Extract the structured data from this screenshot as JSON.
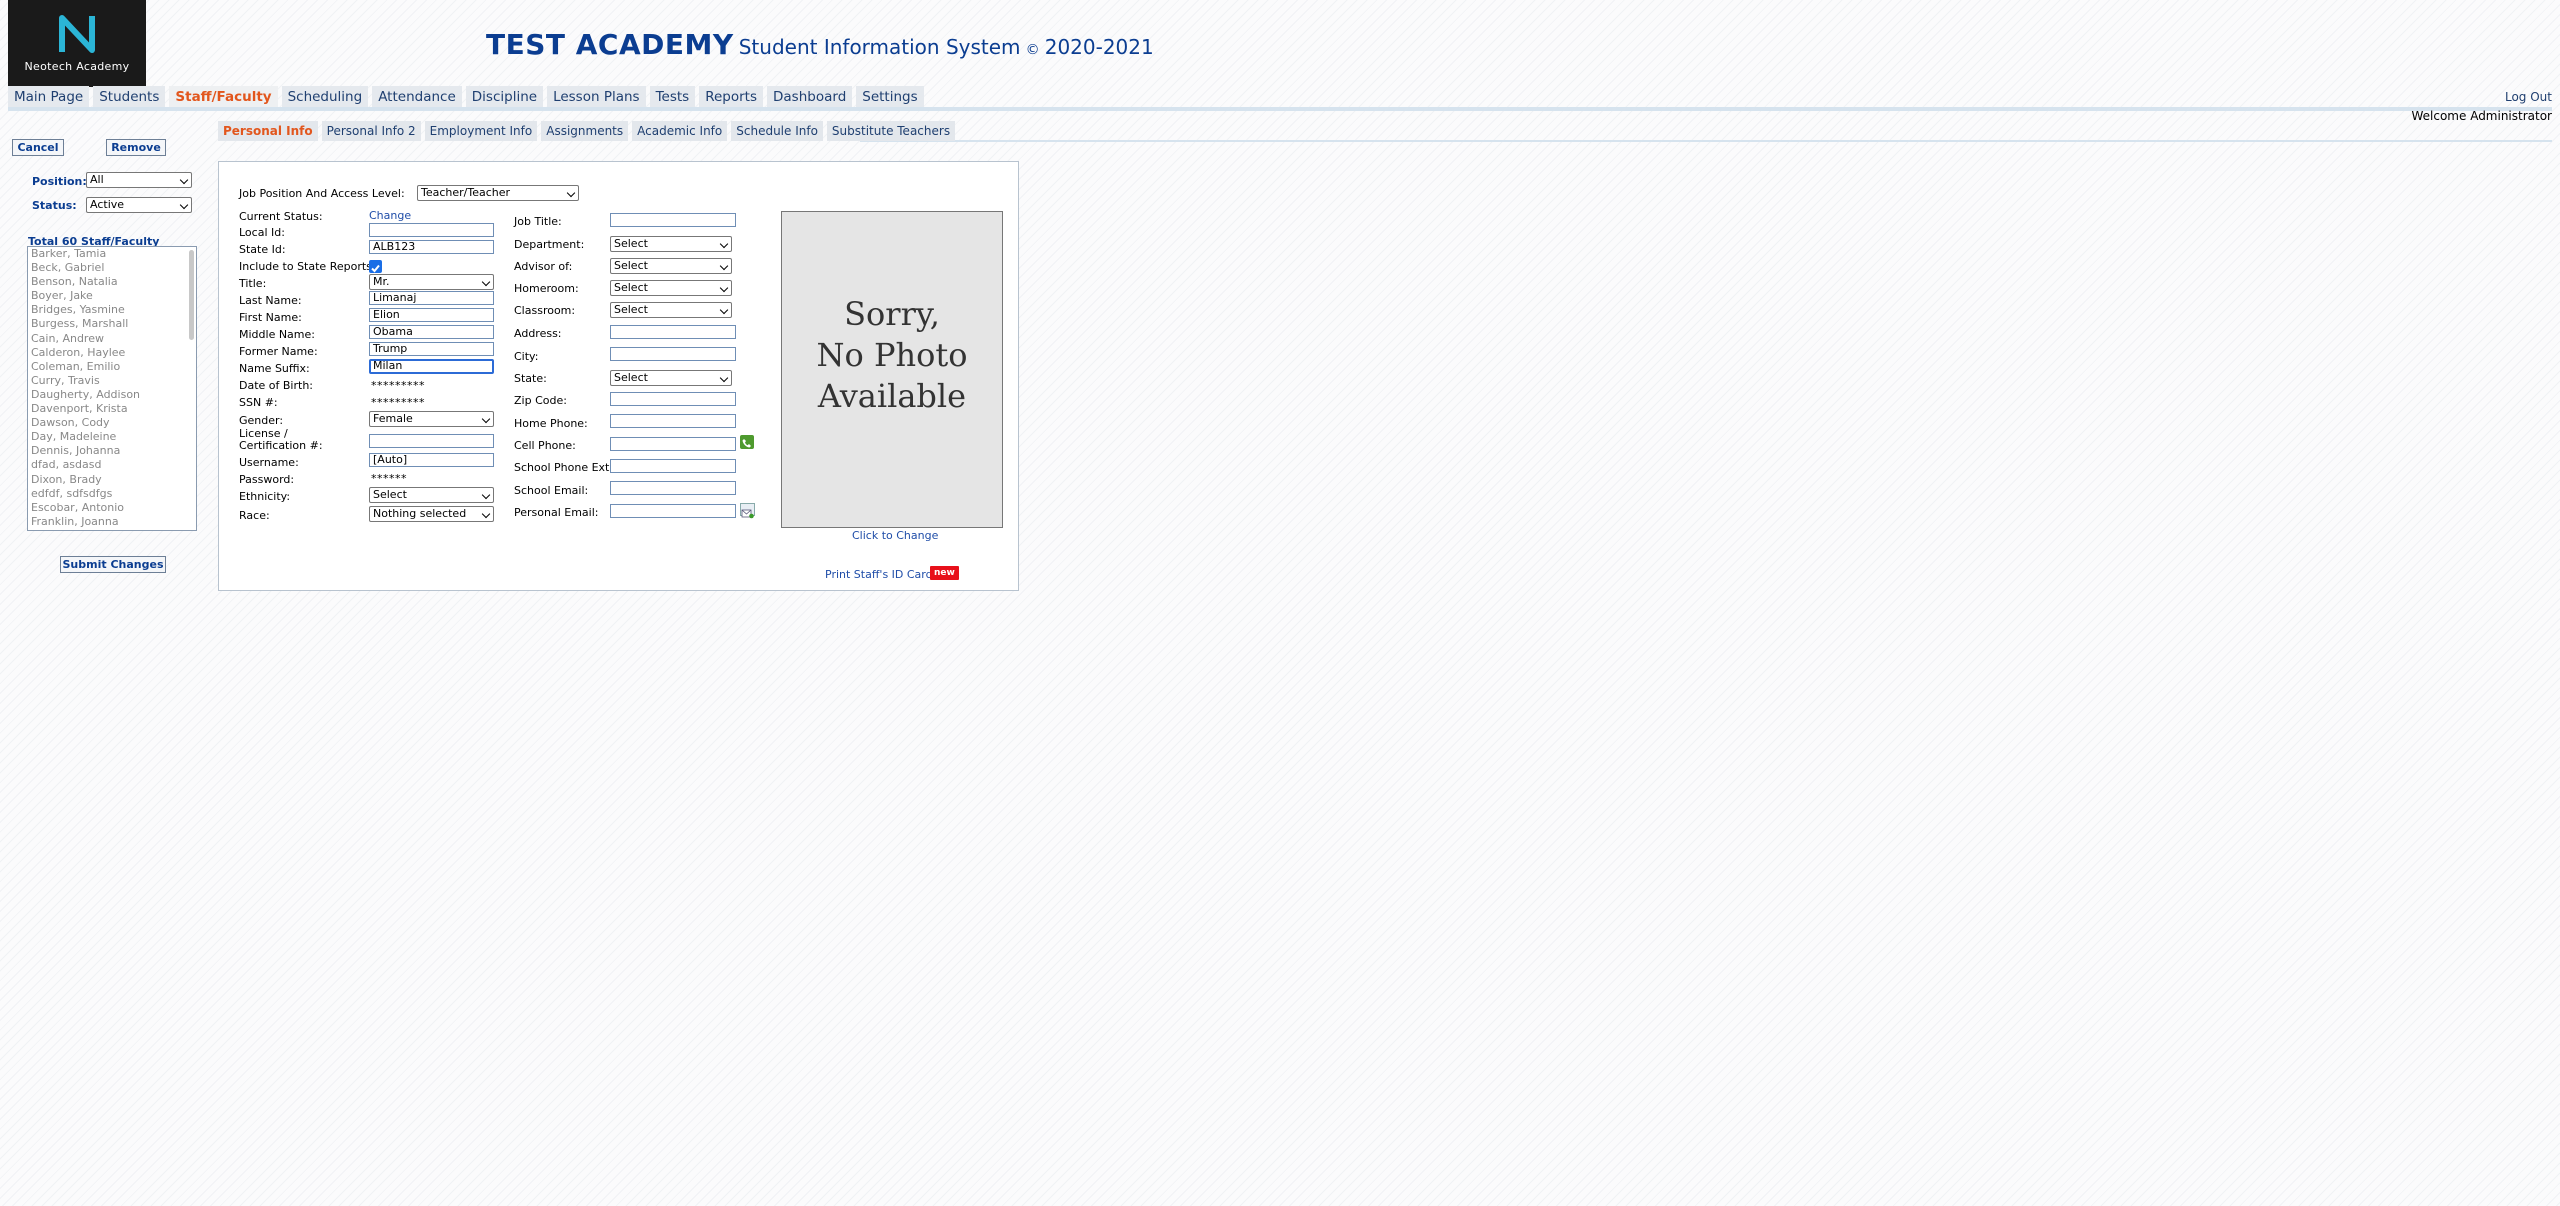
{
  "brand": {
    "logo_text": "Neotech Academy"
  },
  "header": {
    "school": "TEST ACADEMY",
    "system": "Student Information System",
    "copyright": "©",
    "years": "2020-2021"
  },
  "nav": {
    "items": [
      {
        "label": "Main Page"
      },
      {
        "label": "Students"
      },
      {
        "label": "Staff/Faculty",
        "active": true
      },
      {
        "label": "Scheduling"
      },
      {
        "label": "Attendance"
      },
      {
        "label": "Discipline"
      },
      {
        "label": "Lesson Plans"
      },
      {
        "label": "Tests"
      },
      {
        "label": "Reports"
      },
      {
        "label": "Dashboard"
      },
      {
        "label": "Settings"
      }
    ],
    "logout": "Log Out",
    "welcome": "Welcome Administrator"
  },
  "subtabs": [
    {
      "label": "Personal Info",
      "active": true
    },
    {
      "label": "Personal Info 2"
    },
    {
      "label": "Employment Info"
    },
    {
      "label": "Assignments"
    },
    {
      "label": "Academic Info"
    },
    {
      "label": "Schedule Info"
    },
    {
      "label": "Substitute Teachers"
    }
  ],
  "sidebar": {
    "cancel": "Cancel",
    "remove": "Remove",
    "position_label": "Position:",
    "position_value": "All",
    "status_label": "Status:",
    "status_value": "Active",
    "total": "Total 60 Staff/Faculty",
    "staff": [
      "Barker, Tamia",
      "Beck, Gabriel",
      "Benson, Natalia",
      "Boyer, Jake",
      "Bridges, Yasmine",
      "Burgess, Marshall",
      "Cain, Andrew",
      "Calderon, Haylee",
      "Coleman, Emilio",
      "Curry, Travis",
      "Daugherty, Addison",
      "Davenport, Krista",
      "Dawson, Cody",
      "Day, Madeleine",
      "Dennis, Johanna",
      "dfad, asdasd",
      "Dixon, Brady",
      "edfdf, sdfsdfgs",
      "Escobar, Antonio",
      "Franklin, Joanna"
    ],
    "submit": "Submit Changes"
  },
  "form": {
    "job_position_label": "Job Position And Access Level:",
    "job_position_value": "Teacher/Teacher",
    "current_status_label": "Current Status:",
    "change_link": "Change",
    "local_id_label": "Local Id:",
    "local_id": "",
    "state_id_label": "State Id:",
    "state_id": "ALB123",
    "include_state_label": "Include to State Reports:",
    "include_state_checked": true,
    "title_label": "Title:",
    "title_value": "Mr.",
    "last_name_label": "Last Name:",
    "last_name": "Limanaj",
    "first_name_label": "First Name:",
    "first_name": "Elion",
    "middle_name_label": "Middle Name:",
    "middle_name": "Obama",
    "former_name_label": "Former Name:",
    "former_name": "Trump",
    "name_suffix_label": "Name Suffix:",
    "name_suffix": "Milan",
    "dob_label": "Date of Birth:",
    "dob_masked": "*********",
    "ssn_label": "SSN #:",
    "ssn_masked": "*********",
    "gender_label": "Gender:",
    "gender_value": "Female",
    "license_label_1": "License /",
    "license_label_2": "Certification #:",
    "license": "",
    "username_label": "Username:",
    "username": "[Auto]",
    "password_label": "Password:",
    "password_masked": "******",
    "ethnicity_label": "Ethnicity:",
    "ethnicity_value": "Select",
    "race_label": "Race:",
    "race_value": "Nothing selected",
    "job_title_label": "Job Title:",
    "job_title": "",
    "department_label": "Department:",
    "department_value": "Select",
    "advisor_label": "Advisor of:",
    "advisor_value": "Select",
    "homeroom_label": "Homeroom:",
    "homeroom_value": "Select",
    "classroom_label": "Classroom:",
    "classroom_value": "Select",
    "address_label": "Address:",
    "address": "",
    "city_label": "City:",
    "city": "",
    "state_label": "State:",
    "state_value": "Select",
    "zip_label": "Zip Code:",
    "zip": "",
    "home_phone_label": "Home Phone:",
    "home_phone": "",
    "cell_phone_label": "Cell Phone:",
    "cell_phone": "",
    "school_phone_ext_label": "School Phone Ext:",
    "school_phone_ext": "",
    "school_email_label": "School Email:",
    "school_email": "",
    "personal_email_label": "Personal Email:",
    "personal_email": "",
    "photo_line1": "Sorry,",
    "photo_line2": "No Photo",
    "photo_line3": "Available",
    "click_to_change": "Click to Change",
    "print_id_card": "Print Staff's ID Card",
    "new_badge": "new"
  }
}
